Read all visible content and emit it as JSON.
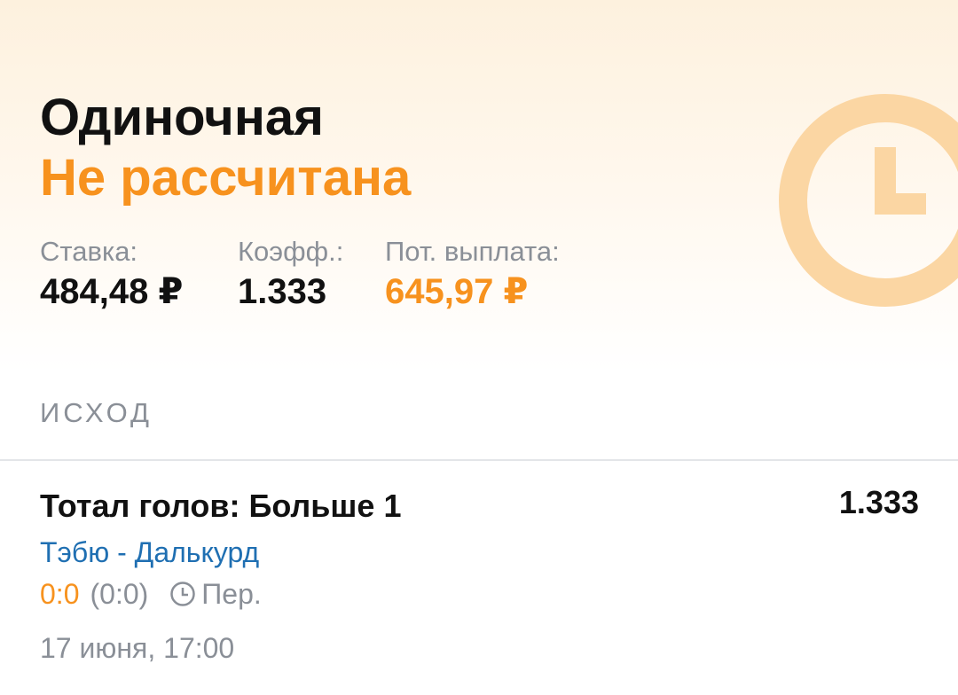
{
  "bet": {
    "type": "Одиночная",
    "status": "Не рассчитана"
  },
  "stats": {
    "stake_label": "Ставка:",
    "stake_value": "484,48 ₽",
    "coef_label": "Коэфф.:",
    "coef_value": "1.333",
    "payout_label": "Пот. выплата:",
    "payout_value": "645,97 ₽"
  },
  "outcome_section": {
    "title": "ИСХОД",
    "outcome_name": "Тотал голов: Больше 1",
    "outcome_coef": "1.333",
    "match": "Тэбю - Далькурд",
    "score": "0:0",
    "half_score": "(0:0)",
    "period": "Пер.",
    "date": "17 июня, 17:00"
  },
  "colors": {
    "accent": "#f7921e",
    "link": "#1f6fb2",
    "muted": "#8a8f97",
    "text": "#111111"
  },
  "icons": {
    "status_watermark": "clock-icon",
    "period": "clock-icon"
  }
}
